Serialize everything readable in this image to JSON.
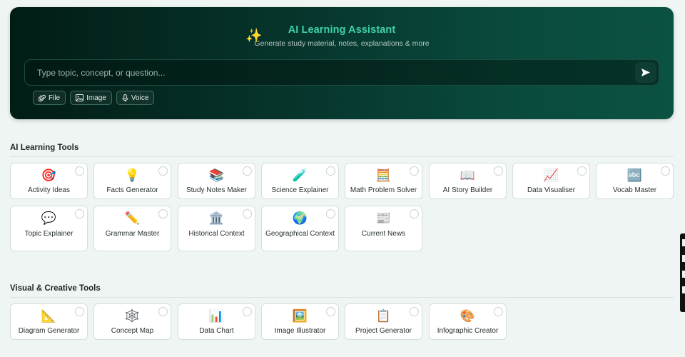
{
  "hero": {
    "title": "AI Learning Assistant",
    "subtitle": "Generate study material, notes, explanations & more",
    "sparkle_icon": "sparkle-icon",
    "input_placeholder": "Type topic, concept, or question...",
    "chips": [
      {
        "label": "File",
        "icon": "paperclip-icon"
      },
      {
        "label": "Image",
        "icon": "image-icon"
      },
      {
        "label": "Voice",
        "icon": "microphone-icon"
      }
    ]
  },
  "sections": {
    "learning": {
      "title": "AI Learning Tools",
      "tools": [
        {
          "label": "Activity Ideas",
          "emoji": "🎯"
        },
        {
          "label": "Facts Generator",
          "emoji": "💡"
        },
        {
          "label": "Study Notes Maker",
          "emoji": "📚"
        },
        {
          "label": "Science Explainer",
          "emoji": "🧪"
        },
        {
          "label": "Math Problem Solver",
          "emoji": "🧮"
        },
        {
          "label": "AI Story Builder",
          "emoji": "📖"
        },
        {
          "label": "Data Visualiser",
          "emoji": "📈"
        },
        {
          "label": "Vocab Master",
          "emoji": "🔤"
        },
        {
          "label": "Topic Explainer",
          "emoji": "💬"
        },
        {
          "label": "Grammar Master",
          "emoji": "✏️"
        },
        {
          "label": "Historical Context",
          "emoji": "🏛️"
        },
        {
          "label": "Geographical Context",
          "emoji": "🌍"
        },
        {
          "label": "Current News",
          "emoji": "📰"
        }
      ]
    },
    "visual": {
      "title": "Visual & Creative Tools",
      "tools": [
        {
          "label": "Diagram Generator",
          "emoji": "📐"
        },
        {
          "label": "Concept Map",
          "emoji": "🕸️"
        },
        {
          "label": "Data Chart",
          "emoji": "📊"
        },
        {
          "label": "Image Illustrator",
          "emoji": "🖼️"
        },
        {
          "label": "Project Generator",
          "emoji": "📋"
        },
        {
          "label": "Infographic Creator",
          "emoji": "🎨"
        }
      ]
    }
  }
}
